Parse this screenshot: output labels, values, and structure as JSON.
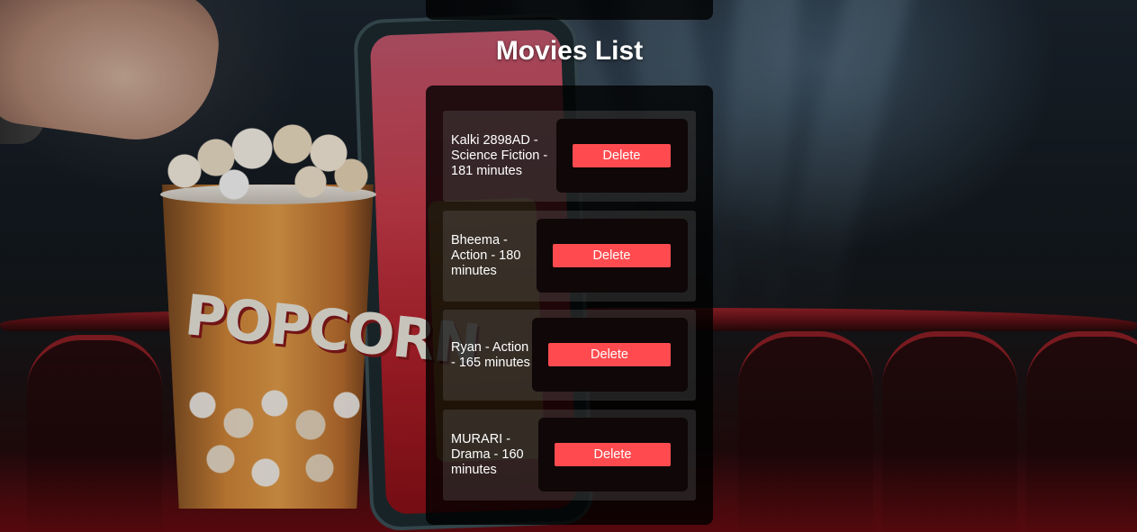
{
  "page": {
    "title": "Movies List"
  },
  "movies": [
    {
      "text": "Kalki 2898AD - Science Fiction - 181 minutes",
      "delete_label": "Delete"
    },
    {
      "text": "Bheema - Action - 180 minutes",
      "delete_label": "Delete"
    },
    {
      "text": "Ryan - Action - 165 minutes",
      "delete_label": "Delete"
    },
    {
      "text": "MURARI - Drama - 160 minutes",
      "delete_label": "Delete"
    }
  ],
  "background": {
    "bucket_text": "POPCORN"
  },
  "colors": {
    "delete_button": "#ff4b4f",
    "panel": "rgba(0,0,0,0.8)",
    "title_text": "#ffffff"
  }
}
